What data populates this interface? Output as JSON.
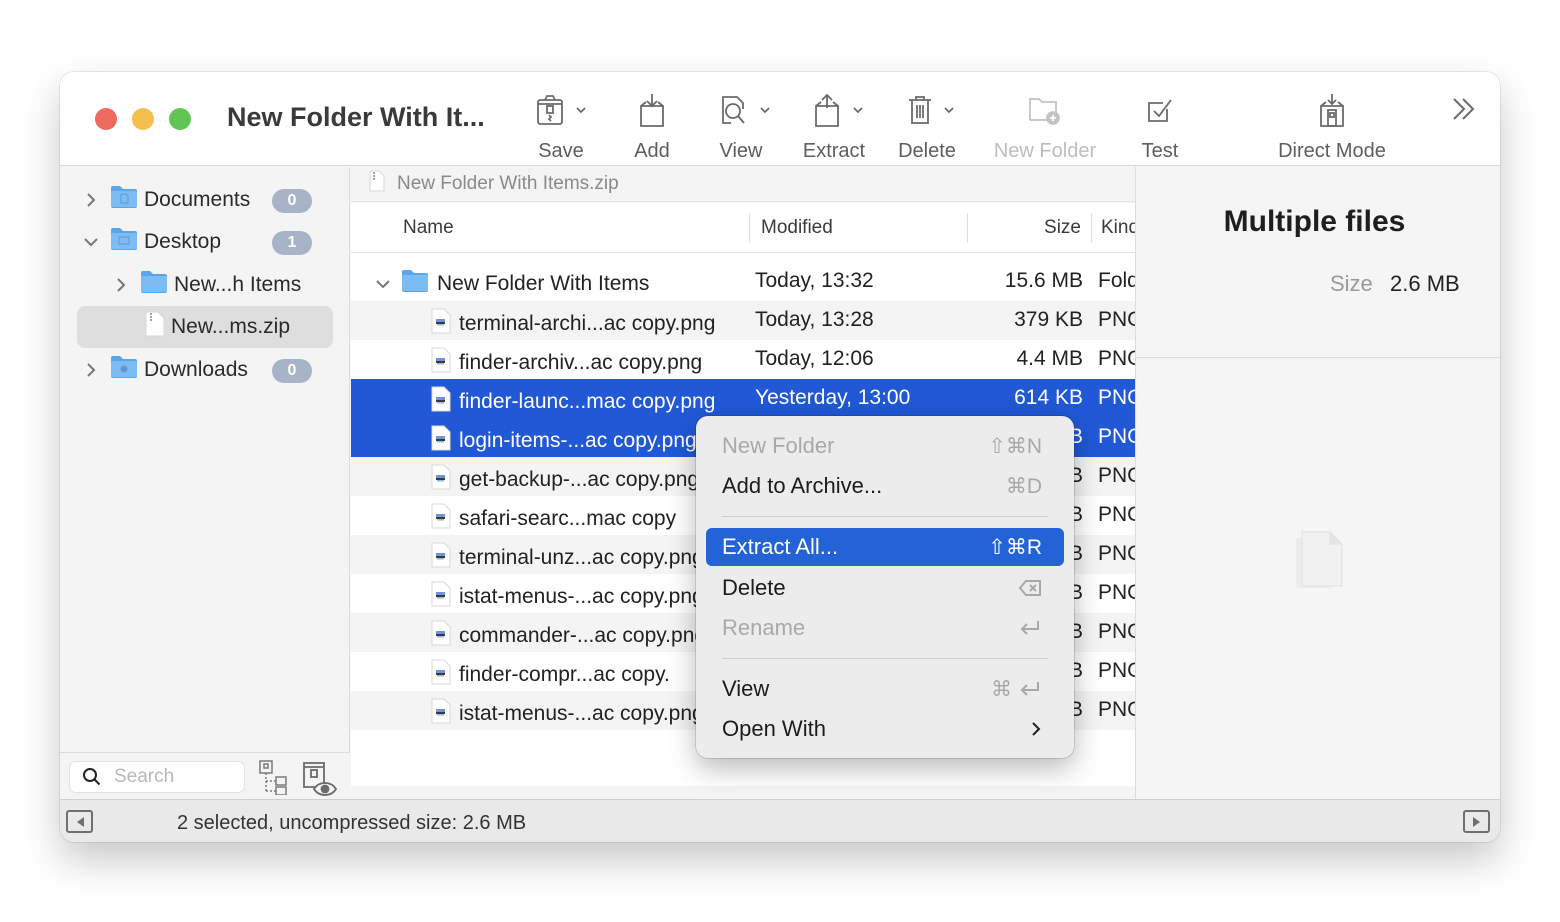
{
  "window": {
    "title": "New Folder With It...",
    "traffic_lights": [
      "close",
      "minimize",
      "zoom"
    ]
  },
  "toolbar": {
    "buttons": [
      {
        "id": "save",
        "label": "Save",
        "icon": "archive-zip-icon",
        "has_menu": true,
        "enabled": true
      },
      {
        "id": "add",
        "label": "Add",
        "icon": "add-to-box-icon",
        "has_menu": false,
        "enabled": true
      },
      {
        "id": "view",
        "label": "View",
        "icon": "view-magnifier-icon",
        "has_menu": true,
        "enabled": true
      },
      {
        "id": "extract",
        "label": "Extract",
        "icon": "extract-box-icon",
        "has_menu": true,
        "enabled": true
      },
      {
        "id": "delete",
        "label": "Delete",
        "icon": "trash-icon",
        "has_menu": true,
        "enabled": true
      },
      {
        "id": "new_folder",
        "label": "New Folder",
        "icon": "folder-plus-icon",
        "has_menu": false,
        "enabled": false
      },
      {
        "id": "test",
        "label": "Test",
        "icon": "checkbox-icon",
        "has_menu": false,
        "enabled": true
      },
      {
        "id": "direct_mode",
        "label": "Direct Mode",
        "icon": "direct-mode-icon",
        "has_menu": false,
        "enabled": true
      }
    ],
    "overflow_icon": "double-chevron-right-icon"
  },
  "sidebar": {
    "items": [
      {
        "label": "Documents",
        "badge": "0",
        "expanded": false,
        "icon": "documents-folder-icon"
      },
      {
        "label": "Desktop",
        "badge": "1",
        "expanded": true,
        "icon": "desktop-folder-icon"
      },
      {
        "label": "New...h Items",
        "expanded": false,
        "icon": "folder-icon"
      },
      {
        "label": "New...ms.zip",
        "selected": true,
        "icon": "zip-file-icon"
      },
      {
        "label": "Downloads",
        "badge": "0",
        "expanded": false,
        "icon": "downloads-folder-icon"
      }
    ],
    "search": {
      "placeholder": "Search",
      "value": ""
    }
  },
  "pathbar": {
    "label": "New Folder With Items.zip"
  },
  "list": {
    "columns": {
      "name": "Name",
      "modified": "Modified",
      "size": "Size",
      "kind": "Kind"
    },
    "rows": [
      {
        "name": "New Folder With Items",
        "modified": "Today, 13:32",
        "size": "15.6 MB",
        "kind": "Folder",
        "type": "folder",
        "expanded": true,
        "selected": false
      },
      {
        "name": "terminal-archi...ac copy.png",
        "modified": "Today, 13:28",
        "size": "379 KB",
        "kind": "PNG",
        "type": "file",
        "selected": false
      },
      {
        "name": "finder-archiv...ac copy.png",
        "modified": "Today, 12:06",
        "size": "4.4 MB",
        "kind": "PNG",
        "type": "file",
        "selected": false
      },
      {
        "name": "finder-launc...mac copy.png",
        "modified": "Yesterday, 13:00",
        "size": "614 KB",
        "kind": "PNG",
        "type": "file",
        "selected": true
      },
      {
        "name": "login-items-...ac copy.png",
        "modified": "",
        "size": "B",
        "kind": "PNG",
        "type": "file",
        "selected": true
      },
      {
        "name": "get-backup-...ac copy.png",
        "modified": "",
        "size": "B",
        "kind": "PNG",
        "type": "file",
        "selected": false
      },
      {
        "name": "safari-searc...mac copy",
        "modified": "",
        "size": "B",
        "kind": "PNG",
        "type": "file",
        "selected": false
      },
      {
        "name": "terminal-unz...ac copy.png",
        "modified": "",
        "size": "B",
        "kind": "PNG",
        "type": "file",
        "selected": false
      },
      {
        "name": "istat-menus-...ac copy.png",
        "modified": "",
        "size": "B",
        "kind": "PNG",
        "type": "file",
        "selected": false
      },
      {
        "name": "commander-...ac copy.png",
        "modified": "",
        "size": "B",
        "kind": "PNG",
        "type": "file",
        "selected": false
      },
      {
        "name": "finder-compr...ac copy.",
        "modified": "",
        "size": "B",
        "kind": "PNG",
        "type": "file",
        "selected": false
      },
      {
        "name": "istat-menus-...ac copy.png",
        "modified": "",
        "size": "B",
        "kind": "PNG",
        "type": "file",
        "selected": false
      }
    ]
  },
  "info_panel": {
    "title": "Multiple files",
    "size_label": "Size",
    "size_value": "2.6 MB"
  },
  "context_menu": {
    "items": [
      {
        "label": "New Folder",
        "shortcut": "⇧⌘N",
        "enabled": false
      },
      {
        "label": "Add to Archive...",
        "shortcut": "⌘D",
        "enabled": true
      },
      {
        "separator": true
      },
      {
        "label": "Extract All...",
        "shortcut": "⇧⌘R",
        "enabled": true,
        "highlighted": true
      },
      {
        "label": "Delete",
        "shortcut": "⌫",
        "enabled": true
      },
      {
        "label": "Rename",
        "shortcut": "↩",
        "enabled": false
      },
      {
        "separator": true
      },
      {
        "label": "View",
        "shortcut": "⌘↩",
        "enabled": true
      },
      {
        "label": "Open With",
        "submenu": true,
        "enabled": true
      }
    ]
  },
  "statusbar": {
    "text": "2 selected, uncompressed size: 2.6 MB"
  },
  "colors": {
    "selection": "#2058d6",
    "menu_highlight": "#2462d8",
    "badge": "#a9b3c8",
    "traffic_red": "#ec6a5e",
    "traffic_yellow": "#f4bf4f",
    "traffic_green": "#61c554"
  }
}
